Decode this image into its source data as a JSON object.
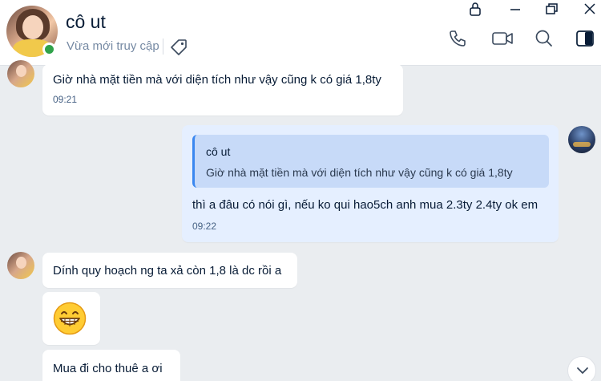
{
  "header": {
    "contact_name": "cô ut",
    "status": "Vừa mới truy cập"
  },
  "icons": {
    "tag": "tag-icon",
    "lock": "lock-icon",
    "minimize": "minimize-icon",
    "restore": "restore-icon",
    "close": "close-icon",
    "call": "phone-icon",
    "video": "video-camera-icon",
    "search": "search-icon",
    "sidebar": "sidebar-toggle-icon",
    "scroll": "chevron-down-icon"
  },
  "messages": [
    {
      "sender": "contact",
      "text": "Giờ nhà mặt tiền mà với diện tích như vậy cũng k có giá 1,8ty",
      "time": "09:21"
    },
    {
      "sender": "me",
      "quote": {
        "author": "cô ut",
        "text": "Giờ nhà mặt tiền mà với diện tích như vậy cũng k có giá 1,8ty"
      },
      "text": "thì a đâu có nói gì, nếu ko qui hao5ch anh mua 2.3ty 2.4ty ok em",
      "time": "09:22"
    },
    {
      "sender": "contact",
      "text": "Dính quy hoạch ng ta xả còn 1,8 là dc rồi a"
    },
    {
      "sender": "contact",
      "emoji": "grinning-face"
    },
    {
      "sender": "contact",
      "text": "Mua đi cho thuê a ơi"
    }
  ],
  "colors": {
    "background": "#eaedf0",
    "bubble_contact": "#ffffff",
    "bubble_mine": "#e5efff",
    "quote_bg": "#c7daf8",
    "quote_bar": "#3a87f0",
    "online": "#30a24a"
  }
}
